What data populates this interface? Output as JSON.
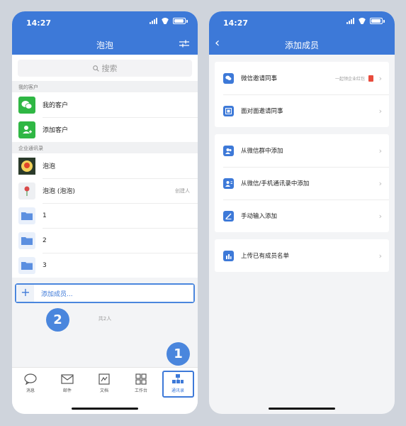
{
  "left": {
    "status_time": "14:27",
    "title": "泡泡",
    "search_placeholder": "搜索",
    "section_customers": "我的客户",
    "customer_items": [
      {
        "label": "我的客户",
        "icon": "wechat-icon"
      },
      {
        "label": "添加客户",
        "icon": "add-person-icon"
      }
    ],
    "section_directory": "企业通讯录",
    "directory_items": [
      {
        "label": "泡泡",
        "note": "",
        "icon": "avatar"
      },
      {
        "label": "泡泡 (泡泡)",
        "note": "创建人",
        "icon": "avatar"
      },
      {
        "label": "1",
        "icon": "folder-icon"
      },
      {
        "label": "2",
        "icon": "folder-icon"
      },
      {
        "label": "3",
        "icon": "folder-icon"
      }
    ],
    "add_member": "添加成员...",
    "count": "共2人",
    "tabs": [
      "消息",
      "邮件",
      "文档",
      "工作台",
      "通讯录"
    ]
  },
  "right": {
    "status_time": "14:27",
    "title": "添加成员",
    "group1": [
      {
        "label": "微信邀请同事",
        "hint": "一起领企业红包"
      },
      {
        "label": "面对面邀请同事"
      }
    ],
    "group2": [
      {
        "label": "从微信群中添加"
      },
      {
        "label": "从微信/手机通讯录中添加"
      },
      {
        "label": "手动输入添加"
      }
    ],
    "group3": [
      {
        "label": "上传已有成员名单"
      }
    ]
  },
  "callouts": [
    "1",
    "2"
  ],
  "colors": {
    "accent": "#3d79d8",
    "green": "#2fb744",
    "red": "#e84c3d"
  }
}
